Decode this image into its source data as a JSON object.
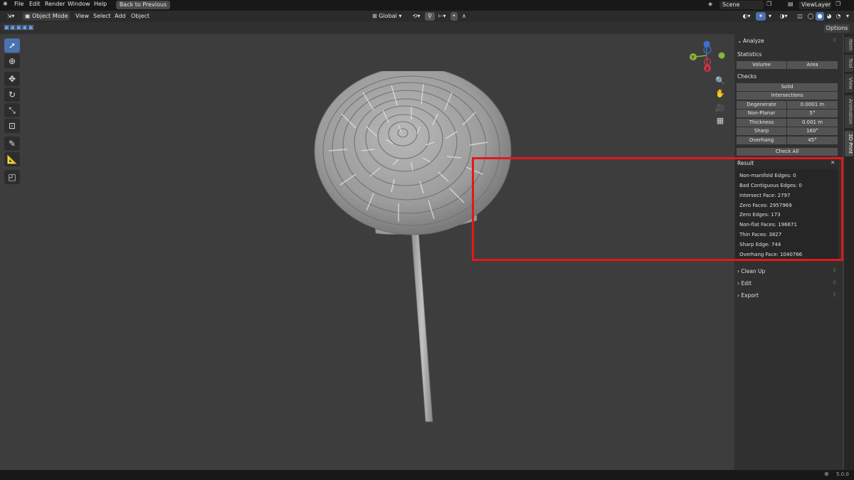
{
  "topbar": {
    "menu": [
      "File",
      "Edit",
      "Render",
      "Window",
      "Help"
    ],
    "back_label": "Back to Previous",
    "scene": "Scene",
    "view_layer": "ViewLayer"
  },
  "header": {
    "mode": "Object Mode",
    "menu": [
      "View",
      "Select",
      "Add",
      "Object"
    ],
    "orientation": "Global"
  },
  "tool_settings": {
    "options_label": "Options"
  },
  "gizmo": {
    "x": "X",
    "y": "Y",
    "z": "Z"
  },
  "sidebar": {
    "tabs": [
      "Item",
      "Tool",
      "View",
      "Animation",
      "3D Print"
    ],
    "active_tab": "3D Print",
    "analyze": {
      "title": "Analyze",
      "statistics_label": "Statistics",
      "volume_label": "Volume",
      "area_label": "Area",
      "checks_label": "Checks",
      "solid_label": "Solid",
      "intersections_label": "Intersections",
      "rows": [
        {
          "label": "Degenerate",
          "value": "0.0001 m"
        },
        {
          "label": "Non-Planar",
          "value": "5°"
        },
        {
          "label": "Thickness",
          "value": "0.001 m"
        },
        {
          "label": "Sharp",
          "value": "160°"
        },
        {
          "label": "Overhang",
          "value": "45°"
        }
      ],
      "check_all_label": "Check All"
    },
    "result": {
      "title": "Result",
      "lines": [
        "Non-manifold Edges: 0",
        "Bad Contiguous Edges: 0",
        "Intersect Face: 2797",
        "Zero Faces: 2957969",
        "Zero Edges: 173",
        "Non-flat Faces: 196671",
        "Thin Faces: 3827",
        "Sharp Edge: 744",
        "Overhang Face: 1040766"
      ]
    },
    "collapsed": [
      "Clean Up",
      "Edit",
      "Export"
    ]
  },
  "status": {
    "version": "5.0.0"
  },
  "colors": {
    "highlight": "#e0191d",
    "accent": "#4a72b0"
  }
}
